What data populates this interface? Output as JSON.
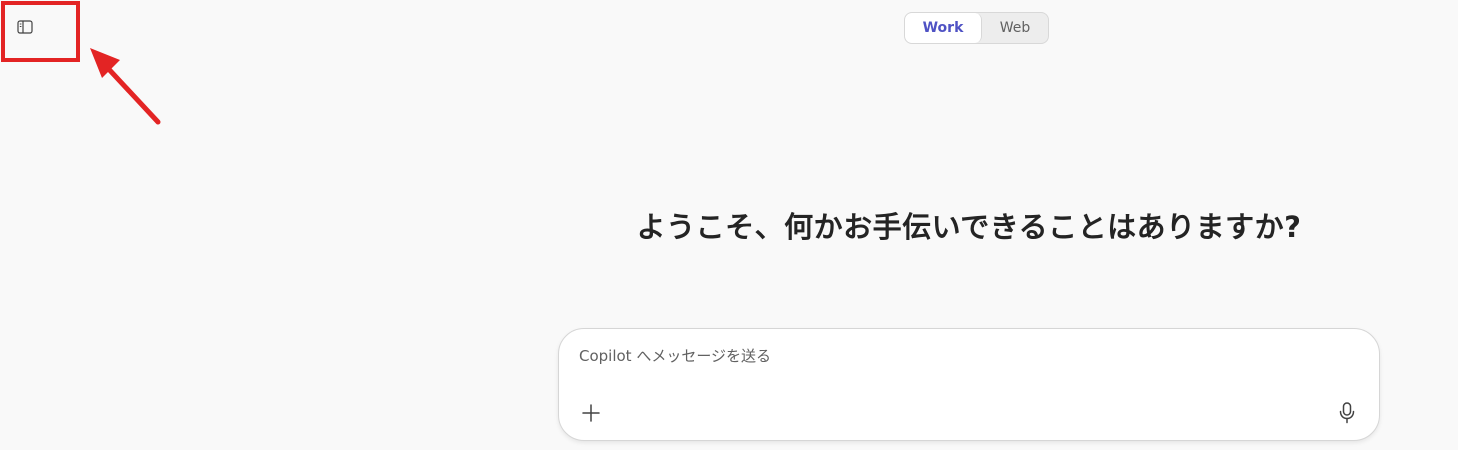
{
  "header": {
    "sidebar_toggle_icon": "sidebar-panel-icon",
    "mode_tabs": [
      {
        "label": "Work",
        "selected": true
      },
      {
        "label": "Web",
        "selected": false
      }
    ]
  },
  "annotation": {
    "color": "#e32424"
  },
  "main": {
    "welcome_text": "ようこそ、何かお手伝いできることはありますか?"
  },
  "composer": {
    "placeholder": "Copilot へメッセージを送る",
    "value": "",
    "add_icon": "plus-icon",
    "mic_icon": "microphone-icon"
  },
  "colors": {
    "background": "#f9f9f9",
    "accent": "#4f52c4",
    "text": "#242424"
  }
}
